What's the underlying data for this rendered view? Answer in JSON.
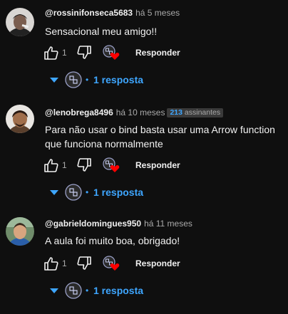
{
  "comments": [
    {
      "author": "@rossinifonseca5683",
      "time": "há 5 meses",
      "text": "Sensacional meu amigo!!",
      "likes": "1",
      "reply_label": "Responder",
      "replies_label": "1 resposta"
    },
    {
      "author": "@lenobrega8496",
      "time": "há 10 meses",
      "badge_count": "213",
      "badge_text": "assinantes",
      "text_line1": "Para não usar o bind basta usar uma Arrow function",
      "text_line2": "que funciona normalmente",
      "likes": "1",
      "reply_label": "Responder",
      "replies_label": "1 resposta"
    },
    {
      "author": "@gabrieldomingues950",
      "time": "há 11 meses",
      "text": "A aula foi muito boa, obrigado!",
      "likes": "1",
      "reply_label": "Responder",
      "replies_label": "1 resposta"
    }
  ],
  "icons": {
    "like": "thumbs-up-icon",
    "dislike": "thumbs-down-icon",
    "heart": "creator-heart-icon",
    "expand": "chevron-down-icon"
  },
  "colors": {
    "background": "#0f0f0f",
    "accent": "#3ea6ff",
    "heart": "#ff0000",
    "secondary_text": "#aaaaaa"
  }
}
